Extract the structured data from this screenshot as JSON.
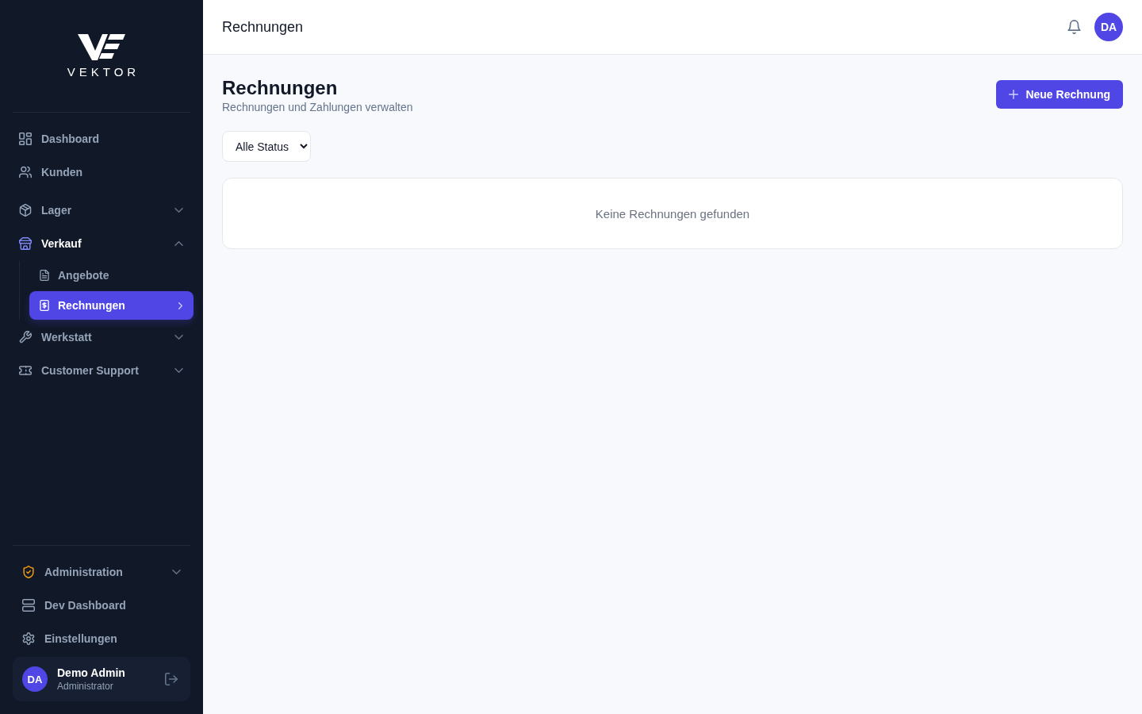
{
  "sidebar": {
    "brand": "VEKTOR",
    "nav_sections": [
      {
        "items": [
          {
            "label": "Dashboard",
            "kind": "link",
            "selected": false
          },
          {
            "label": "Kunden",
            "kind": "link",
            "selected": false
          }
        ]
      },
      {
        "items": [
          {
            "label": "Lager",
            "kind": "group",
            "expanded": false
          },
          {
            "label": "Verkauf",
            "kind": "group",
            "expanded": true,
            "children": [
              {
                "label": "Angebote",
                "selected": false
              },
              {
                "label": "Rechnungen",
                "selected": true
              }
            ]
          },
          {
            "label": "Werkstatt",
            "kind": "group",
            "expanded": false
          },
          {
            "label": "Customer Support",
            "kind": "group",
            "expanded": false
          }
        ]
      }
    ],
    "footer_items": [
      {
        "label": "Administration",
        "kind": "group",
        "expanded": false
      },
      {
        "label": "Dev Dashboard",
        "kind": "link",
        "selected": false
      },
      {
        "label": "Einstellungen",
        "kind": "link",
        "selected": false
      }
    ],
    "user": {
      "initials": "DA",
      "name": "Demo Admin",
      "role": "Administrator"
    }
  },
  "header": {
    "title": "Rechnungen",
    "avatar_initials": "DA"
  },
  "page": {
    "title": "Rechnungen",
    "subtitle": "Rechnungen und Zahlungen verwalten",
    "primary_button": "Neue Rechnung",
    "status_filter": {
      "value": "Alle Status"
    },
    "empty_message": "Keine Rechnungen gefunden"
  }
}
